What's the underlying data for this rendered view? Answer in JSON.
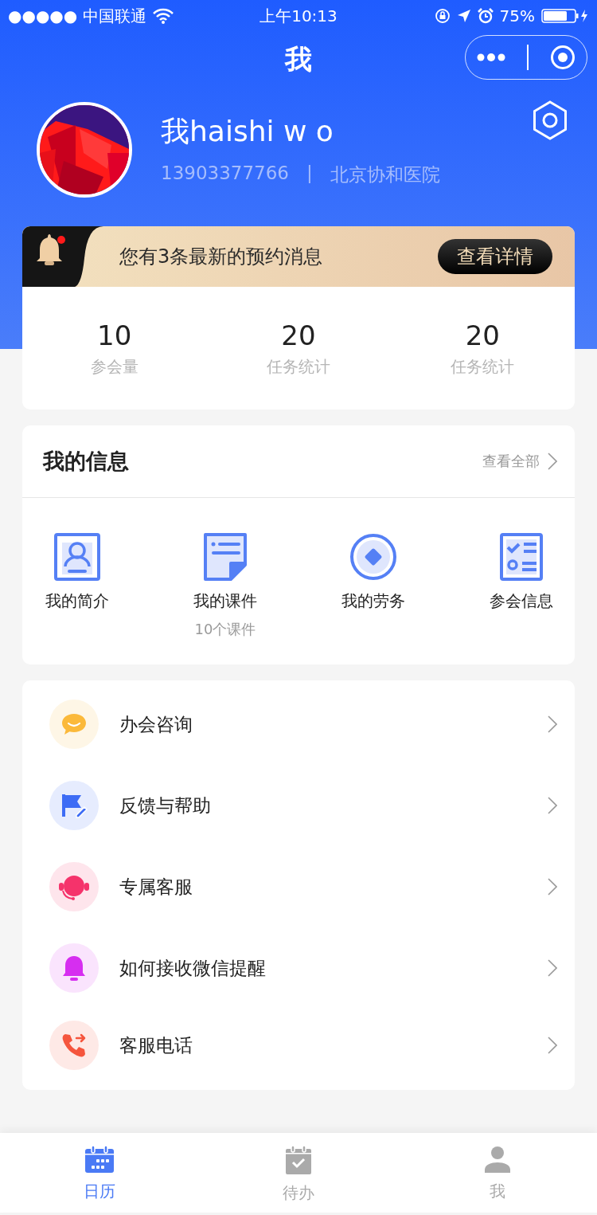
{
  "status_bar": {
    "carrier": "●●●●● 中国联通",
    "time": "上午10:13",
    "battery": "75%"
  },
  "nav": {
    "title": "我"
  },
  "profile": {
    "name": "我haishi w o",
    "phone": "13903377766",
    "separator": "|",
    "hospital": "北京协和医院"
  },
  "notice": {
    "text": "您有3条最新的预约消息",
    "button": "查看详情",
    "unread": true
  },
  "stats": [
    {
      "value": "10",
      "label": "参会量"
    },
    {
      "value": "20",
      "label": "任务统计"
    },
    {
      "value": "20",
      "label": "任务统计"
    }
  ],
  "info": {
    "title": "我的信息",
    "more": "查看全部",
    "items": [
      {
        "kind": "profile",
        "label": "我的简介"
      },
      {
        "kind": "courseware",
        "label": "我的课件",
        "sub": "10个课件"
      },
      {
        "kind": "service",
        "label": "我的劳务"
      },
      {
        "kind": "meeting",
        "label": "参会信息"
      }
    ]
  },
  "menu": [
    {
      "kind": "chat",
      "label": "办会咨询",
      "color": "#fbb93a"
    },
    {
      "kind": "flag",
      "label": "反馈与帮助",
      "color": "#3d6cf5"
    },
    {
      "kind": "headset",
      "label": "专属客服",
      "color": "#f5336b"
    },
    {
      "kind": "bell",
      "label": "如何接收微信提醒",
      "color": "#d62ef0"
    },
    {
      "kind": "phone",
      "label": "客服电话",
      "color": "#f5553d"
    }
  ],
  "tabs": [
    {
      "kind": "calendar",
      "label": "日历",
      "selected": true
    },
    {
      "kind": "todo",
      "label": "待办",
      "selected": false
    },
    {
      "kind": "person",
      "label": "我",
      "selected": false
    }
  ]
}
